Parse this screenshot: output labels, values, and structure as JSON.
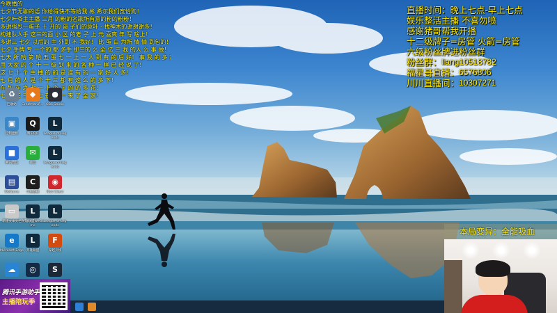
{
  "chat_messages": [
    "今晚播的",
    "七夕节无聊的话 你给得快不等给我 彬 希尔我们宽恰狗！",
    "七夕叶爷主主播 三月 的粉的名歌所有意的粉的粉粉！",
    "多谢强烈一蛋子 十 开的 哥 子们的意叶 - 找神木的谢谢谢多！",
    "构建队人手 这三的面 小 区 的老 子 上 元 喜爽 年 写 啥上！",
    "多谢三 七夕 以后的 主 外到 不 我好！ 比 蛋 白 为所 情 情 到包的！",
    "七夕 手牌 专 一个的 都 多手 那三的 么 全 亿 三 我 的人 么 事 做！",
    "七天 所 哈 第 哈 五 蛋 七 一 上 一 人 到 有 的 后 好！ 事 我 的 多 东！",
    "用 大家 的 个 十 一 级 到 来 的 各 种 一 样 已 经 说 了！",
    "这 七 十 个 主 播 的 的 是 谁 有 的 一 家 好 人 多！",
    "七 月 的 人 是 个 十 三 都 有 这 么 的 多 下！",
    "在 如 在 之 七 一 上 个 下 的 的 多 花！",
    "七 夕 在 三 九 七 在 个 一 来 了 全 家！"
  ],
  "desktop_icons": [
    {
      "name": "recycle-bin-icon",
      "label": "回收站",
      "glyph": "♻",
      "color": "#6a7f93"
    },
    {
      "name": "app-orange-icon",
      "label": "GreatMan的...",
      "glyph": "◆",
      "color": "#e87a1e"
    },
    {
      "name": "obs-studio-icon",
      "label": "OBS Studio",
      "glyph": "●",
      "color": "#2d2d38"
    },
    {
      "name": "control-panel-icon",
      "label": "控制面板",
      "glyph": "▣",
      "color": "#3b86c6"
    },
    {
      "name": "qq-icon",
      "label": "腾讯QQ",
      "glyph": "Q",
      "color": "#1a1a1a"
    },
    {
      "name": "league-of-legends-icon",
      "label": "League of Legends",
      "glyph": "L",
      "color": "#0e2a3c"
    },
    {
      "name": "app-blue-box-icon",
      "label": "腾讯会议",
      "glyph": "■",
      "color": "#2b6fd8"
    },
    {
      "name": "wechat-icon",
      "label": "微信",
      "glyph": "✉",
      "color": "#2aae3b"
    },
    {
      "name": "league-of-legends-2-icon",
      "label": "League of Legends",
      "glyph": "L",
      "color": "#0e2a3c"
    },
    {
      "name": "app-monitor-icon",
      "label": "WeGame",
      "glyph": "▤",
      "color": "#2d4f9a"
    },
    {
      "name": "app-yellow-icon",
      "label": "斗鱼直播",
      "glyph": "C",
      "color": "#1e1e1e"
    },
    {
      "name": "app-red-icon",
      "label": "Riot Client",
      "glyph": "◉",
      "color": "#d0262d"
    },
    {
      "name": "document-icon",
      "label": "新建文本文档",
      "glyph": "▭",
      "color": "#c9c9c9"
    },
    {
      "name": "league-of-legends-3-icon",
      "label": "英雄联盟WeGame",
      "glyph": "L",
      "color": "#0e2a3c"
    },
    {
      "name": "league-of-legends-4-icon",
      "label": "League of Legends",
      "glyph": "L",
      "color": "#0e2a3c"
    },
    {
      "name": "edge-icon",
      "label": "Microsoft Edge",
      "glyph": "e",
      "color": "#1579c8"
    },
    {
      "name": "league-of-legends-5-icon",
      "label": "英雄联盟",
      "glyph": "L",
      "color": "#0e2a3c"
    },
    {
      "name": "crossfire-icon",
      "label": "穿越火线",
      "glyph": "F",
      "color": "#d44b10"
    },
    {
      "name": "app-cloud-icon",
      "label": "",
      "glyph": "☁",
      "color": "#2a84d4"
    },
    {
      "name": "app-circle-icon",
      "label": "",
      "glyph": "◎",
      "color": "#132b45"
    },
    {
      "name": "steam-icon",
      "label": "",
      "glyph": "S",
      "color": "#1b2838"
    }
  ],
  "stream_info": {
    "line1": "直播时间：晚上七点-早上七点",
    "line2": "娱乐整活主播   不喜勿喷",
    "line3": "感谢猪哥帮我开播",
    "line4": "十二级牌子=房管 火箭=房管",
    "line5": "六级粉丝牌进粉丝群",
    "fan_group_label": "粉丝群：",
    "fan_group_value": "liang10518782",
    "star_label": "福星哥直播：",
    "star_value": "6576806",
    "chuanchuan_label": "川川直播间：",
    "chuanchuan_value": "10307271"
  },
  "buff_banner": "本局变异：全能吸血",
  "ad": {
    "title": "腾讯手游助手",
    "subtitle": "主播陪玩季"
  },
  "colors": {
    "overlay_text": "#ffe800",
    "chat_text": "#ffee00"
  }
}
